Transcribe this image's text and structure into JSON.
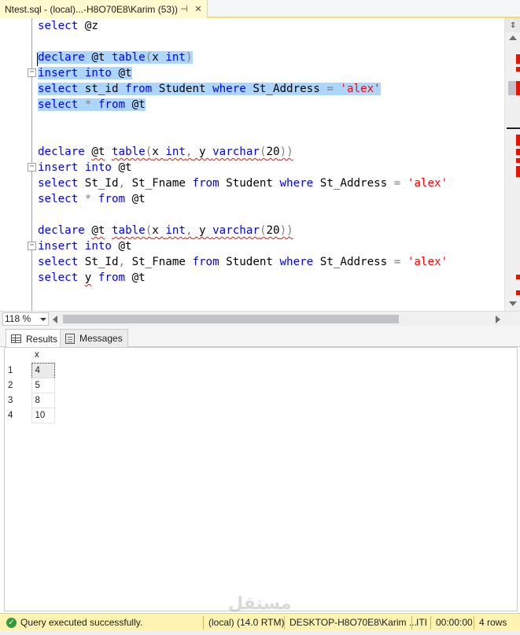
{
  "tab": {
    "title": "Ntest.sql - (local)...-H8O70E8\\Karim (53))",
    "pin_icon": "pin-icon",
    "close_icon": "close-icon"
  },
  "editor": {
    "lines": [
      {
        "tokens": [
          [
            "kw",
            "select"
          ],
          [
            "tx",
            " @z"
          ]
        ]
      },
      {
        "tokens": []
      },
      {
        "selected": true,
        "tokens": [
          [
            "kw",
            "declare"
          ],
          [
            "tx",
            " @t "
          ],
          [
            "kw",
            "table"
          ],
          [
            "op",
            "("
          ],
          [
            "tx",
            "x "
          ],
          [
            "kw",
            "int"
          ],
          [
            "op",
            ")"
          ]
        ]
      },
      {
        "selected": true,
        "tokens": [
          [
            "kw",
            "insert"
          ],
          [
            "tx",
            " "
          ],
          [
            "kw",
            "into"
          ],
          [
            "tx",
            " @t"
          ]
        ]
      },
      {
        "selected": true,
        "tokens": [
          [
            "kw",
            "select"
          ],
          [
            "tx",
            " st_id "
          ],
          [
            "kw",
            "from"
          ],
          [
            "tx",
            " Student "
          ],
          [
            "kw",
            "where"
          ],
          [
            "tx",
            " St_Address "
          ],
          [
            "op",
            "="
          ],
          [
            "tx",
            " "
          ],
          [
            "str",
            "'alex'"
          ]
        ]
      },
      {
        "selected": true,
        "tokens": [
          [
            "kw",
            "select"
          ],
          [
            "tx",
            " "
          ],
          [
            "op",
            "*"
          ],
          [
            "tx",
            " "
          ],
          [
            "kw",
            "from"
          ],
          [
            "tx",
            " @t"
          ]
        ]
      },
      {
        "tokens": []
      },
      {
        "tokens": []
      },
      {
        "tokens": [
          [
            "kw",
            "declare"
          ],
          [
            "tx",
            " "
          ],
          [
            "sq",
            "@t"
          ],
          [
            "tx",
            " "
          ],
          [
            "kwsq",
            "table"
          ],
          [
            "opsq",
            "("
          ],
          [
            "sq",
            "x "
          ],
          [
            "kwsq",
            "int"
          ],
          [
            "opsq",
            ","
          ],
          [
            "sq",
            " y "
          ],
          [
            "kwsq",
            "varchar"
          ],
          [
            "opsq",
            "("
          ],
          [
            "sq",
            "20"
          ],
          [
            "opsq",
            "))"
          ]
        ]
      },
      {
        "tokens": [
          [
            "kw",
            "insert"
          ],
          [
            "tx",
            " "
          ],
          [
            "kw",
            "into"
          ],
          [
            "tx",
            " @t"
          ]
        ]
      },
      {
        "tokens": [
          [
            "kw",
            "select"
          ],
          [
            "tx",
            " St_Id"
          ],
          [
            "op",
            ","
          ],
          [
            "tx",
            " St_Fname "
          ],
          [
            "kw",
            "from"
          ],
          [
            "tx",
            " Student "
          ],
          [
            "kw",
            "where"
          ],
          [
            "tx",
            " St_Address "
          ],
          [
            "op",
            "="
          ],
          [
            "tx",
            " "
          ],
          [
            "str",
            "'alex'"
          ]
        ]
      },
      {
        "tokens": [
          [
            "kw",
            "select"
          ],
          [
            "tx",
            " "
          ],
          [
            "op",
            "*"
          ],
          [
            "tx",
            " "
          ],
          [
            "kw",
            "from"
          ],
          [
            "tx",
            " @t"
          ]
        ]
      },
      {
        "tokens": []
      },
      {
        "tokens": [
          [
            "kw",
            "declare"
          ],
          [
            "tx",
            " "
          ],
          [
            "sq",
            "@t"
          ],
          [
            "tx",
            " "
          ],
          [
            "kwsq",
            "table"
          ],
          [
            "opsq",
            "("
          ],
          [
            "sq",
            "x "
          ],
          [
            "kwsq",
            "int"
          ],
          [
            "opsq",
            ","
          ],
          [
            "sq",
            " y "
          ],
          [
            "kwsq",
            "varchar"
          ],
          [
            "opsq",
            "("
          ],
          [
            "sq",
            "20"
          ],
          [
            "opsq",
            "))"
          ]
        ]
      },
      {
        "tokens": [
          [
            "kw",
            "insert"
          ],
          [
            "tx",
            " "
          ],
          [
            "kw",
            "into"
          ],
          [
            "tx",
            " @t"
          ]
        ]
      },
      {
        "tokens": [
          [
            "kw",
            "select"
          ],
          [
            "tx",
            " St_Id"
          ],
          [
            "op",
            ","
          ],
          [
            "tx",
            " St_Fname "
          ],
          [
            "kw",
            "from"
          ],
          [
            "tx",
            " Student "
          ],
          [
            "kw",
            "where"
          ],
          [
            "tx",
            " St_Address "
          ],
          [
            "op",
            "="
          ],
          [
            "tx",
            " "
          ],
          [
            "str",
            "'alex'"
          ]
        ]
      },
      {
        "tokens": [
          [
            "kw",
            "select"
          ],
          [
            "tx",
            " "
          ],
          [
            "sq",
            "y"
          ],
          [
            "tx",
            " "
          ],
          [
            "kw",
            "from"
          ],
          [
            "tx",
            " @t"
          ]
        ]
      }
    ],
    "fold_markers": [
      "−",
      "−",
      "−"
    ],
    "split_icon": "⇕"
  },
  "zoom": {
    "value": "118 %"
  },
  "results": {
    "tabs": [
      {
        "label": "Results",
        "icon": "grid-icon",
        "active": true
      },
      {
        "label": "Messages",
        "icon": "messages-icon",
        "active": false
      }
    ],
    "columns": [
      "x"
    ],
    "rows": [
      {
        "num": "1",
        "x": "4"
      },
      {
        "num": "2",
        "x": "5"
      },
      {
        "num": "3",
        "x": "8"
      },
      {
        "num": "4",
        "x": "10"
      }
    ]
  },
  "status": {
    "message": "Query executed successfully.",
    "server": "(local) (14.0 RTM)",
    "login": "DESKTOP-H8O70E8\\Karim ...",
    "database": "ITI",
    "elapsed": "00:00:00",
    "rows": "4 rows",
    "ok_icon": "check-circle-icon",
    "color": "#fff3b1"
  }
}
